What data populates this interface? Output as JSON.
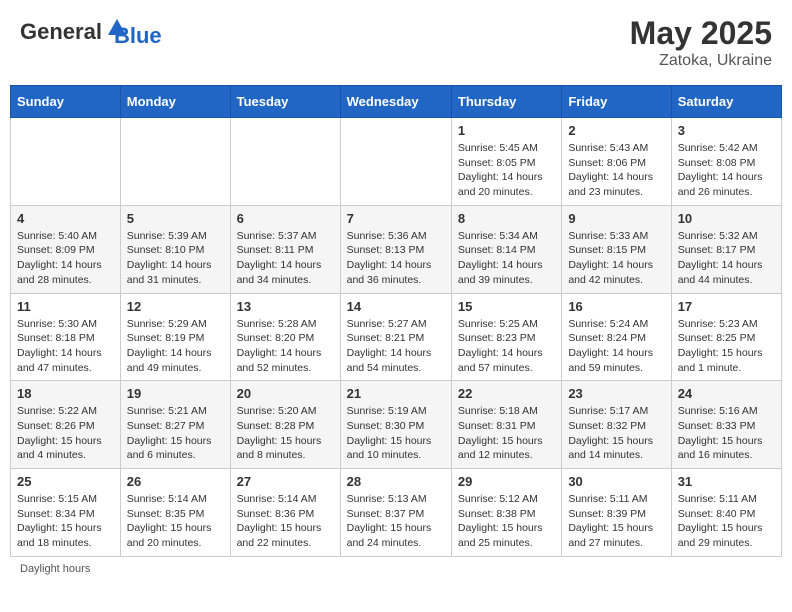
{
  "header": {
    "logo_general": "General",
    "logo_blue": "Blue",
    "month": "May 2025",
    "location": "Zatoka, Ukraine"
  },
  "days_of_week": [
    "Sunday",
    "Monday",
    "Tuesday",
    "Wednesday",
    "Thursday",
    "Friday",
    "Saturday"
  ],
  "weeks": [
    [
      {
        "day": "",
        "info": ""
      },
      {
        "day": "",
        "info": ""
      },
      {
        "day": "",
        "info": ""
      },
      {
        "day": "",
        "info": ""
      },
      {
        "day": "1",
        "sunrise": "5:45 AM",
        "sunset": "8:05 PM",
        "daylight": "14 hours and 20 minutes."
      },
      {
        "day": "2",
        "sunrise": "5:43 AM",
        "sunset": "8:06 PM",
        "daylight": "14 hours and 23 minutes."
      },
      {
        "day": "3",
        "sunrise": "5:42 AM",
        "sunset": "8:08 PM",
        "daylight": "14 hours and 26 minutes."
      }
    ],
    [
      {
        "day": "4",
        "sunrise": "5:40 AM",
        "sunset": "8:09 PM",
        "daylight": "14 hours and 28 minutes."
      },
      {
        "day": "5",
        "sunrise": "5:39 AM",
        "sunset": "8:10 PM",
        "daylight": "14 hours and 31 minutes."
      },
      {
        "day": "6",
        "sunrise": "5:37 AM",
        "sunset": "8:11 PM",
        "daylight": "14 hours and 34 minutes."
      },
      {
        "day": "7",
        "sunrise": "5:36 AM",
        "sunset": "8:13 PM",
        "daylight": "14 hours and 36 minutes."
      },
      {
        "day": "8",
        "sunrise": "5:34 AM",
        "sunset": "8:14 PM",
        "daylight": "14 hours and 39 minutes."
      },
      {
        "day": "9",
        "sunrise": "5:33 AM",
        "sunset": "8:15 PM",
        "daylight": "14 hours and 42 minutes."
      },
      {
        "day": "10",
        "sunrise": "5:32 AM",
        "sunset": "8:17 PM",
        "daylight": "14 hours and 44 minutes."
      }
    ],
    [
      {
        "day": "11",
        "sunrise": "5:30 AM",
        "sunset": "8:18 PM",
        "daylight": "14 hours and 47 minutes."
      },
      {
        "day": "12",
        "sunrise": "5:29 AM",
        "sunset": "8:19 PM",
        "daylight": "14 hours and 49 minutes."
      },
      {
        "day": "13",
        "sunrise": "5:28 AM",
        "sunset": "8:20 PM",
        "daylight": "14 hours and 52 minutes."
      },
      {
        "day": "14",
        "sunrise": "5:27 AM",
        "sunset": "8:21 PM",
        "daylight": "14 hours and 54 minutes."
      },
      {
        "day": "15",
        "sunrise": "5:25 AM",
        "sunset": "8:23 PM",
        "daylight": "14 hours and 57 minutes."
      },
      {
        "day": "16",
        "sunrise": "5:24 AM",
        "sunset": "8:24 PM",
        "daylight": "14 hours and 59 minutes."
      },
      {
        "day": "17",
        "sunrise": "5:23 AM",
        "sunset": "8:25 PM",
        "daylight": "15 hours and 1 minute."
      }
    ],
    [
      {
        "day": "18",
        "sunrise": "5:22 AM",
        "sunset": "8:26 PM",
        "daylight": "15 hours and 4 minutes."
      },
      {
        "day": "19",
        "sunrise": "5:21 AM",
        "sunset": "8:27 PM",
        "daylight": "15 hours and 6 minutes."
      },
      {
        "day": "20",
        "sunrise": "5:20 AM",
        "sunset": "8:28 PM",
        "daylight": "15 hours and 8 minutes."
      },
      {
        "day": "21",
        "sunrise": "5:19 AM",
        "sunset": "8:30 PM",
        "daylight": "15 hours and 10 minutes."
      },
      {
        "day": "22",
        "sunrise": "5:18 AM",
        "sunset": "8:31 PM",
        "daylight": "15 hours and 12 minutes."
      },
      {
        "day": "23",
        "sunrise": "5:17 AM",
        "sunset": "8:32 PM",
        "daylight": "15 hours and 14 minutes."
      },
      {
        "day": "24",
        "sunrise": "5:16 AM",
        "sunset": "8:33 PM",
        "daylight": "15 hours and 16 minutes."
      }
    ],
    [
      {
        "day": "25",
        "sunrise": "5:15 AM",
        "sunset": "8:34 PM",
        "daylight": "15 hours and 18 minutes."
      },
      {
        "day": "26",
        "sunrise": "5:14 AM",
        "sunset": "8:35 PM",
        "daylight": "15 hours and 20 minutes."
      },
      {
        "day": "27",
        "sunrise": "5:14 AM",
        "sunset": "8:36 PM",
        "daylight": "15 hours and 22 minutes."
      },
      {
        "day": "28",
        "sunrise": "5:13 AM",
        "sunset": "8:37 PM",
        "daylight": "15 hours and 24 minutes."
      },
      {
        "day": "29",
        "sunrise": "5:12 AM",
        "sunset": "8:38 PM",
        "daylight": "15 hours and 25 minutes."
      },
      {
        "day": "30",
        "sunrise": "5:11 AM",
        "sunset": "8:39 PM",
        "daylight": "15 hours and 27 minutes."
      },
      {
        "day": "31",
        "sunrise": "5:11 AM",
        "sunset": "8:40 PM",
        "daylight": "15 hours and 29 minutes."
      }
    ]
  ],
  "footer": {
    "note": "Daylight hours"
  }
}
